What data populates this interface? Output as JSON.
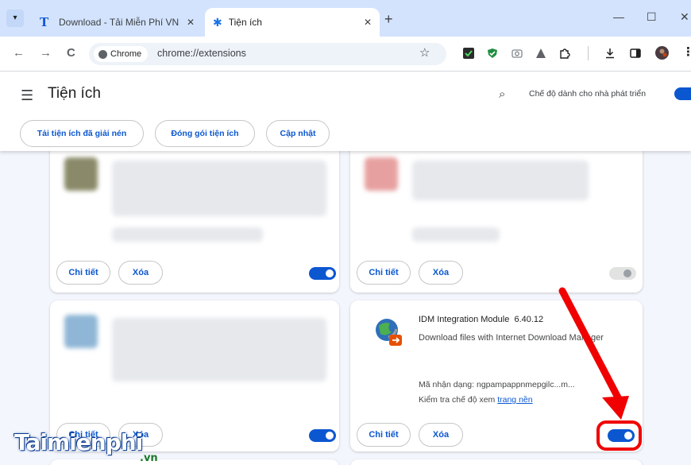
{
  "browser": {
    "tabs": [
      {
        "title": "Download - Tải Miễn Phí VN - P",
        "favicon": "T",
        "active": false
      },
      {
        "title": "Tiện ích",
        "favicon": "puzzle-icon",
        "active": true
      }
    ],
    "new_tab_label": "+",
    "chip_label": "Chrome",
    "url": "chrome://extensions"
  },
  "header": {
    "title": "Tiện ích",
    "dev_mode_label": "Chế độ dành cho nhà phát triển",
    "dev_mode_on": true,
    "actions": [
      "Tải tiện ích đã giải nén",
      "Đóng gói tiện ích",
      "Cập nhật"
    ]
  },
  "cards": {
    "details_label": "Chi tiết",
    "remove_label": "Xóa"
  },
  "idm": {
    "name": "IDM Integration Module",
    "version": "6.40.12",
    "description": "Download files with Internet Download Manager",
    "id_label": "Mã nhận dạng:",
    "id_value": "ngpampappnmepgilc...m...",
    "inspect_label": "Kiểm tra chế độ xem",
    "inspect_link": "trang nền",
    "enabled": true
  },
  "watermark": {
    "main": "Taimienphi",
    "suffix": ".vn"
  },
  "colors": {
    "accent": "#0b57d0",
    "highlight": "#f00000",
    "tabstrip": "#d3e3fd"
  }
}
